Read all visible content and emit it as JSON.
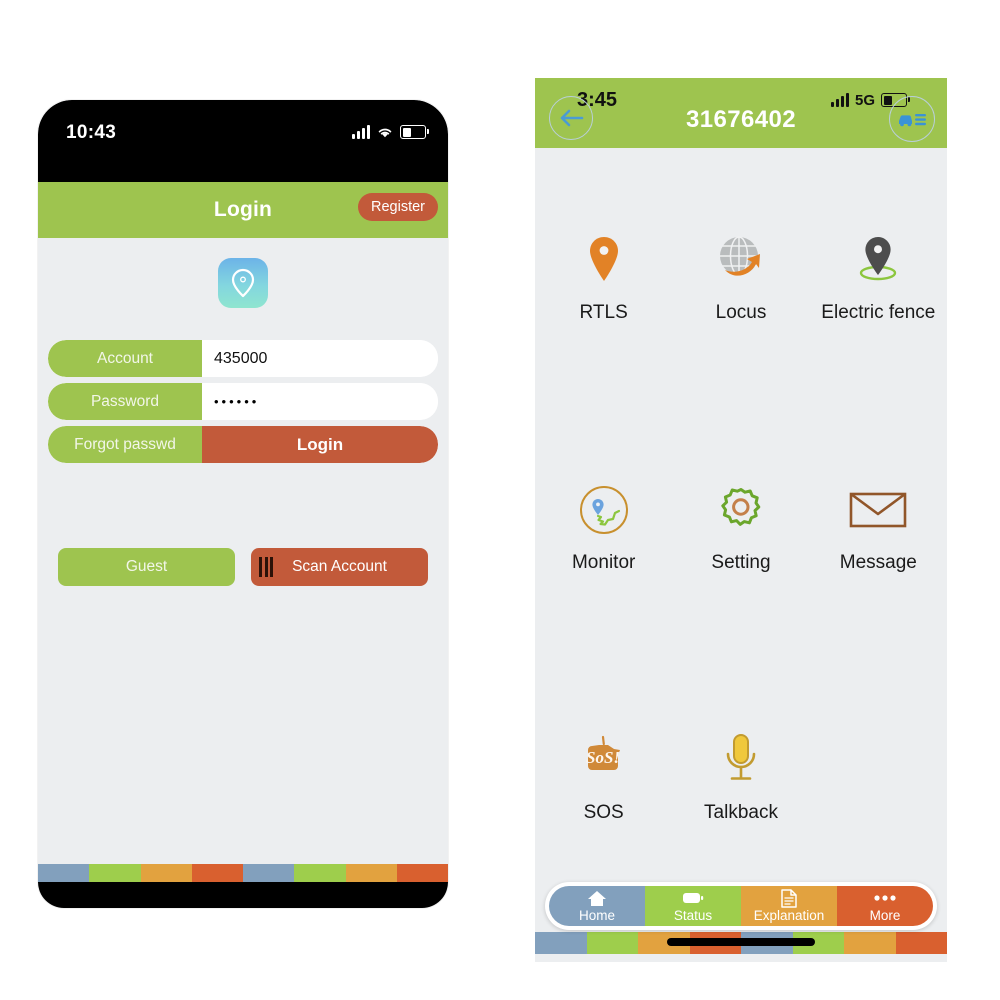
{
  "login_screen": {
    "status_bar": {
      "time": "10:43",
      "signal_icon": "signal-bars-icon",
      "wifi_icon": "wifi-icon",
      "battery_icon": "battery-icon"
    },
    "header": {
      "title": "Login",
      "register_label": "Register"
    },
    "logo_icon": "map-pin-logo-icon",
    "fields": [
      {
        "label": "Account",
        "value": "435000",
        "placeholder": "Account"
      },
      {
        "label": "Password",
        "value": "••••••",
        "placeholder": "Password"
      }
    ],
    "action_row": {
      "forgot_label": "Forgot passwd",
      "login_label": "Login"
    },
    "buttons": {
      "guest_label": "Guest",
      "scan_label": "Scan Account",
      "scan_icon": "barcode-icon"
    }
  },
  "device_screen": {
    "status_bar": {
      "time": "3:45",
      "signal_icon": "signal-bars-icon",
      "network": "5G",
      "battery_icon": "battery-icon"
    },
    "header": {
      "back_icon": "arrow-left-icon",
      "device_id": "31676402",
      "vehicle_icon": "car-list-icon"
    },
    "menu": [
      {
        "label": "RTLS",
        "icon": "map-pin-icon"
      },
      {
        "label": "Locus",
        "icon": "globe-arrow-icon"
      },
      {
        "label": "Electric fence",
        "icon": "geofence-pin-icon"
      },
      {
        "label": "Monitor",
        "icon": "route-circle-icon"
      },
      {
        "label": "Setting",
        "icon": "gear-icon"
      },
      {
        "label": "Message",
        "icon": "envelope-icon"
      },
      {
        "label": "SOS",
        "icon": "sos-bubble-icon"
      },
      {
        "label": "Talkback",
        "icon": "microphone-icon"
      }
    ],
    "bottom_nav": [
      {
        "label": "Home",
        "icon": "home-icon",
        "color": "#82a0bd"
      },
      {
        "label": "Status",
        "icon": "battery-status-icon",
        "color": "#9ece4c"
      },
      {
        "label": "Explanation",
        "icon": "document-icon",
        "color": "#e2a23f"
      },
      {
        "label": "More",
        "icon": "more-dots-icon",
        "color": "#d9602f"
      }
    ]
  },
  "palette": {
    "green": "#9ec44f",
    "rust": "#c25a3a",
    "bg": "#eceef0",
    "stripe": [
      "#82a0bd",
      "#9ece4c",
      "#e2a23f",
      "#d9602f"
    ]
  }
}
